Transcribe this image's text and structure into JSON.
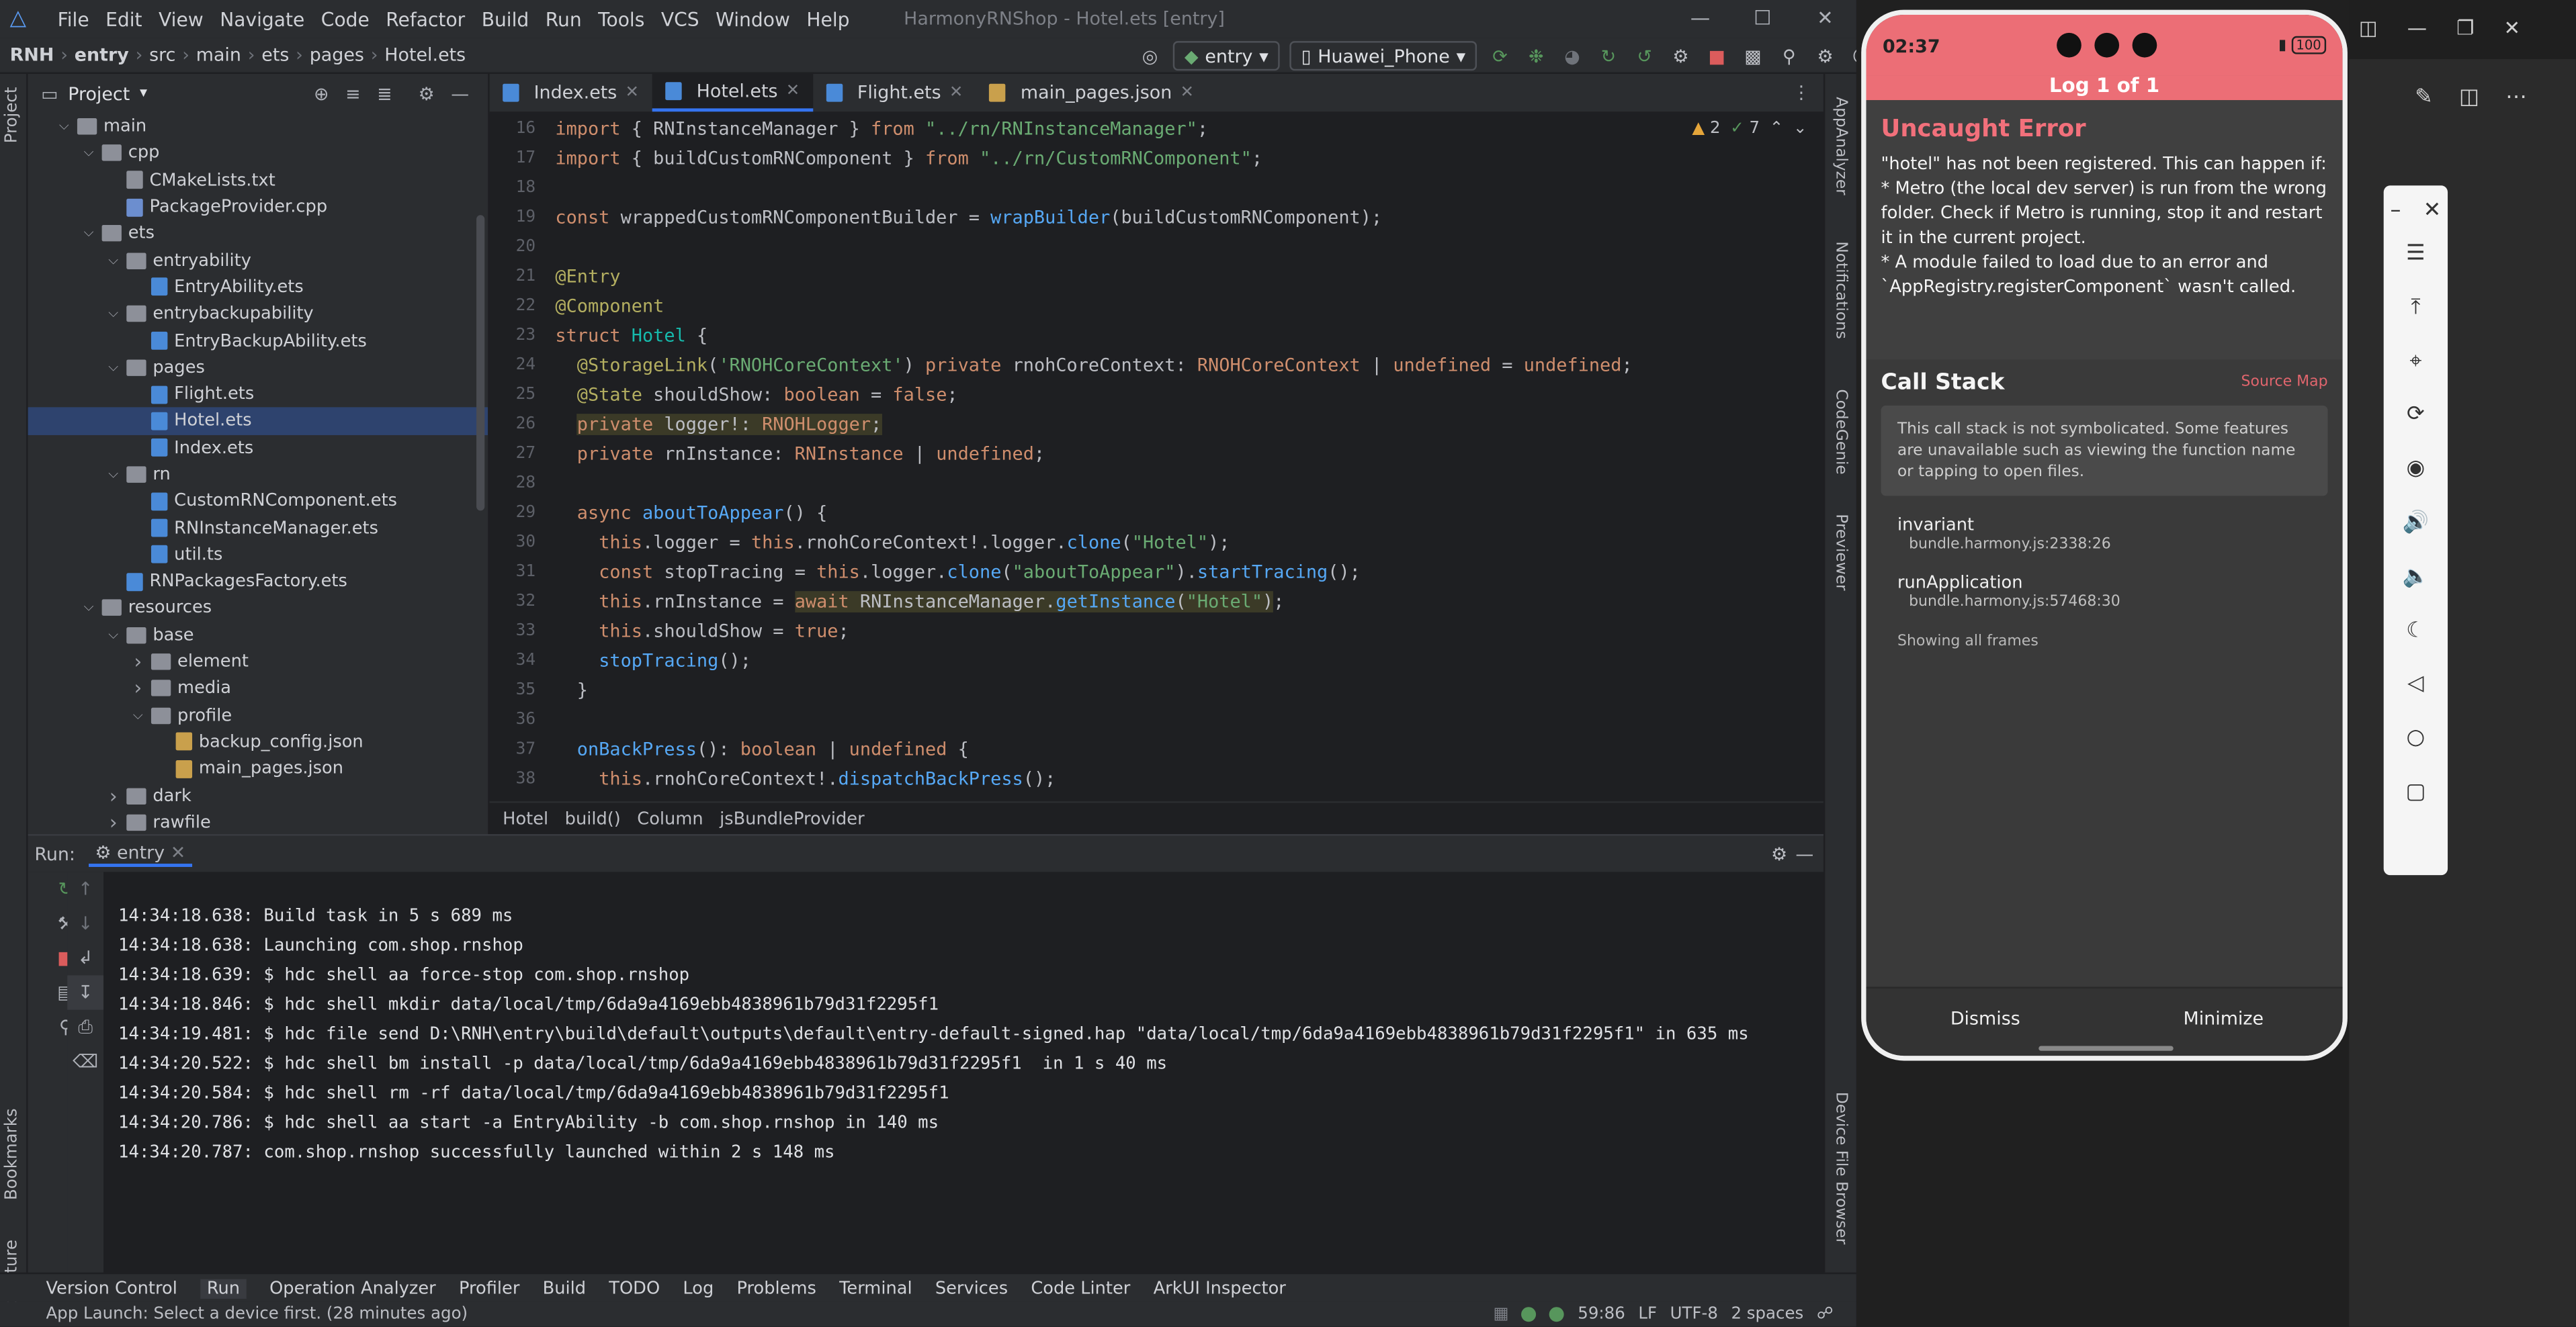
{
  "titlebar": {
    "menu": [
      "File",
      "Edit",
      "View",
      "Navigate",
      "Code",
      "Refactor",
      "Build",
      "Run",
      "Tools",
      "VCS",
      "Window",
      "Help"
    ],
    "window_title": "HarmonyRNShop - Hotel.ets [entry]"
  },
  "breadcrumbs": [
    "RNH",
    "entry",
    "src",
    "main",
    "ets",
    "pages",
    "Hotel.ets"
  ],
  "toolbar": {
    "config": "entry",
    "device": "Huawei_Phone"
  },
  "project": {
    "title": "Project",
    "tree": [
      {
        "label": "main",
        "indent": 3,
        "type": "folder",
        "arrow": "v"
      },
      {
        "label": "cpp",
        "indent": 4,
        "type": "folder",
        "arrow": "v"
      },
      {
        "label": "CMakeLists.txt",
        "indent": 5,
        "type": "txt",
        "arrow": ""
      },
      {
        "label": "PackageProvider.cpp",
        "indent": 5,
        "type": "cpp",
        "arrow": ""
      },
      {
        "label": "ets",
        "indent": 4,
        "type": "folder",
        "arrow": "v"
      },
      {
        "label": "entryability",
        "indent": 5,
        "type": "folder",
        "arrow": "v"
      },
      {
        "label": "EntryAbility.ets",
        "indent": 6,
        "type": "ets",
        "arrow": ""
      },
      {
        "label": "entrybackupability",
        "indent": 5,
        "type": "folder",
        "arrow": "v"
      },
      {
        "label": "EntryBackupAbility.ets",
        "indent": 6,
        "type": "ets",
        "arrow": ""
      },
      {
        "label": "pages",
        "indent": 5,
        "type": "folder",
        "arrow": "v"
      },
      {
        "label": "Flight.ets",
        "indent": 6,
        "type": "ets",
        "arrow": ""
      },
      {
        "label": "Hotel.ets",
        "indent": 6,
        "type": "ets",
        "arrow": "",
        "selected": true
      },
      {
        "label": "Index.ets",
        "indent": 6,
        "type": "ets",
        "arrow": ""
      },
      {
        "label": "rn",
        "indent": 5,
        "type": "folder",
        "arrow": "v"
      },
      {
        "label": "CustomRNComponent.ets",
        "indent": 6,
        "type": "ets",
        "arrow": ""
      },
      {
        "label": "RNInstanceManager.ets",
        "indent": 6,
        "type": "ets",
        "arrow": ""
      },
      {
        "label": "util.ts",
        "indent": 6,
        "type": "ets",
        "arrow": ""
      },
      {
        "label": "RNPackagesFactory.ets",
        "indent": 5,
        "type": "ets",
        "arrow": ""
      },
      {
        "label": "resources",
        "indent": 4,
        "type": "folder",
        "arrow": "v"
      },
      {
        "label": "base",
        "indent": 5,
        "type": "folder",
        "arrow": "v"
      },
      {
        "label": "element",
        "indent": 6,
        "type": "folder",
        "arrow": ">"
      },
      {
        "label": "media",
        "indent": 6,
        "type": "folder",
        "arrow": ">"
      },
      {
        "label": "profile",
        "indent": 6,
        "type": "folder",
        "arrow": "v"
      },
      {
        "label": "backup_config.json",
        "indent": 7,
        "type": "json",
        "arrow": ""
      },
      {
        "label": "main_pages.json",
        "indent": 7,
        "type": "json",
        "arrow": ""
      },
      {
        "label": "dark",
        "indent": 5,
        "type": "folder",
        "arrow": ">"
      },
      {
        "label": "rawfile",
        "indent": 5,
        "type": "folder",
        "arrow": ">"
      }
    ]
  },
  "tabs": [
    {
      "label": "Index.ets",
      "active": false
    },
    {
      "label": "Hotel.ets",
      "active": true
    },
    {
      "label": "Flight.ets",
      "active": false
    },
    {
      "label": "main_pages.json",
      "active": false
    }
  ],
  "inspections": {
    "warnings": "2",
    "weak": "7"
  },
  "code": [
    {
      "n": "16",
      "html": "<span class='kw'>import</span> { RNInstanceManager } <span class='kw'>from</span> <span class='str'>\"../rn/RNInstanceManager\"</span>;"
    },
    {
      "n": "17",
      "html": "<span class='kw'>import</span> { buildCustomRNComponent } <span class='kw'>from</span> <span class='str'>\"../rn/CustomRNComponent\"</span>;"
    },
    {
      "n": "18",
      "html": ""
    },
    {
      "n": "19",
      "html": "<span class='kw'>const</span> wrappedCustomRNComponentBuilder = <span class='fn'>wrapBuilder</span>(buildCustomRNComponent);"
    },
    {
      "n": "20",
      "html": ""
    },
    {
      "n": "21",
      "html": "<span class='an'>@Entry</span>"
    },
    {
      "n": "22",
      "html": "<span class='an'>@Component</span>"
    },
    {
      "n": "23",
      "html": "<span class='kw'>struct</span> <span class='ty2'>Hotel</span> {"
    },
    {
      "n": "24",
      "html": "  <span class='an'>@StorageLink</span>(<span class='str'>'RNOHCoreContext'</span>) <span class='kw'>private</span> rnohCoreContext: <span class='kw'>RNOHCoreContext</span> | <span class='kw'>undefined</span> = <span class='kw'>undefined</span>;"
    },
    {
      "n": "25",
      "html": "  <span class='an'>@State</span> shouldShow: <span class='kw'>boolean</span> = <span class='kw'>false</span>;"
    },
    {
      "n": "26",
      "html": "  <span class='hl'><span class='kw'>private</span> logger!: <span class='kw'>RNOHLogger</span>;</span>"
    },
    {
      "n": "27",
      "html": "  <span class='kw'>private</span> rnInstance: <span class='kw'>RNInstance</span> | <span class='kw'>undefined</span>;"
    },
    {
      "n": "28",
      "html": ""
    },
    {
      "n": "29",
      "html": "  <span class='kw'>async</span> <span class='fn'>aboutToAppear</span>() {"
    },
    {
      "n": "30",
      "html": "    <span class='kw'>this</span>.logger = <span class='kw'>this</span>.rnohCoreContext!.logger.<span class='fn'>clone</span>(<span class='str'>\"Hotel\"</span>);"
    },
    {
      "n": "31",
      "html": "    <span class='kw'>const</span> stopTracing = <span class='kw'>this</span>.logger.<span class='fn'>clone</span>(<span class='str'>\"aboutToAppear\"</span>).<span class='fn'>startTracing</span>();"
    },
    {
      "n": "32",
      "html": "    <span class='kw'>this</span>.rnInstance = <span class='hl'><span class='kw'>await</span> RNInstanceManager.<span class='fn'>getInstance</span>(<span class='str'>\"Hotel\"</span>)</span>;"
    },
    {
      "n": "33",
      "html": "    <span class='kw'>this</span>.shouldShow = <span class='kw'>true</span>;"
    },
    {
      "n": "34",
      "html": "    <span class='fn'>stopTracing</span>();"
    },
    {
      "n": "35",
      "html": "  }"
    },
    {
      "n": "36",
      "html": ""
    },
    {
      "n": "37",
      "html": "  <span class='fn'>onBackPress</span>(): <span class='kw'>boolean</span> | <span class='kw'>undefined</span> {"
    },
    {
      "n": "38",
      "html": "    <span class='kw'>this</span>.rnohCoreContext!.<span class='fn'>dispatchBackPress</span>();"
    }
  ],
  "editor_crumbs": [
    "Hotel",
    "build()",
    "Column",
    "jsBundleProvider"
  ],
  "run": {
    "label": "Run:",
    "config": "entry",
    "lines": [
      "14:34:18.638: Build task in 5 s 689 ms",
      "14:34:18.638: Launching com.shop.rnshop",
      "14:34:18.639: $ hdc shell aa force-stop com.shop.rnshop",
      "14:34:18.846: $ hdc shell mkdir data/local/tmp/6da9a4169ebb4838961b79d31f2295f1",
      "14:34:19.481: $ hdc file send D:\\RNH\\entry\\build\\default\\outputs\\default\\entry-default-signed.hap \"data/local/tmp/6da9a4169ebb4838961b79d31f2295f1\" in 635 ms",
      "14:34:20.522: $ hdc shell bm install -p data/local/tmp/6da9a4169ebb4838961b79d31f2295f1  in 1 s 40 ms",
      "14:34:20.584: $ hdc shell rm -rf data/local/tmp/6da9a4169ebb4838961b79d31f2295f1",
      "14:34:20.786: $ hdc shell aa start -a EntryAbility -b com.shop.rnshop in 140 ms",
      "14:34:20.787: com.shop.rnshop successfully launched within 2 s 148 ms"
    ]
  },
  "left_strip": [
    "Project",
    "Bookmarks",
    "Structure"
  ],
  "right_strip": [
    "AppAnalyzer",
    "Notifications",
    "CodeGenie",
    "Previewer",
    "Device File Browser"
  ],
  "bottom_tools": [
    "Version Control",
    "Run",
    "Operation Analyzer",
    "Profiler",
    "Build",
    "TODO",
    "Log",
    "Problems",
    "Terminal",
    "Services",
    "Code Linter",
    "ArkUI Inspector"
  ],
  "status": {
    "message": "App Launch: Select a device first. (28 minutes ago)",
    "position": "59:86",
    "line_sep": "LF",
    "encoding": "UTF-8",
    "indent": "2 spaces"
  },
  "phone": {
    "time": "02:37",
    "battery": "100",
    "log_counter": "Log 1 of 1",
    "error_title": "Uncaught Error",
    "error_message": [
      "\"hotel\" has not been registered. This can happen if:",
      "* Metro (the local dev server) is run from the wrong folder. Check if Metro is running, stop it and restart it in the current project.",
      "* A module failed to load due to an error and `AppRegistry.registerComponent` wasn't called."
    ],
    "callstack_title": "Call Stack",
    "source_map": "Source Map",
    "note": "This call stack is not symbolicated. Some features are unavailable such as viewing the function name or tapping to open files.",
    "frames": [
      {
        "name": "invariant",
        "loc": "bundle.harmony.js:2338:26"
      },
      {
        "name": "runApplication",
        "loc": "bundle.harmony.js:57468:30"
      }
    ],
    "all_frames": "Showing all frames",
    "dismiss": "Dismiss",
    "minimize": "Minimize"
  }
}
